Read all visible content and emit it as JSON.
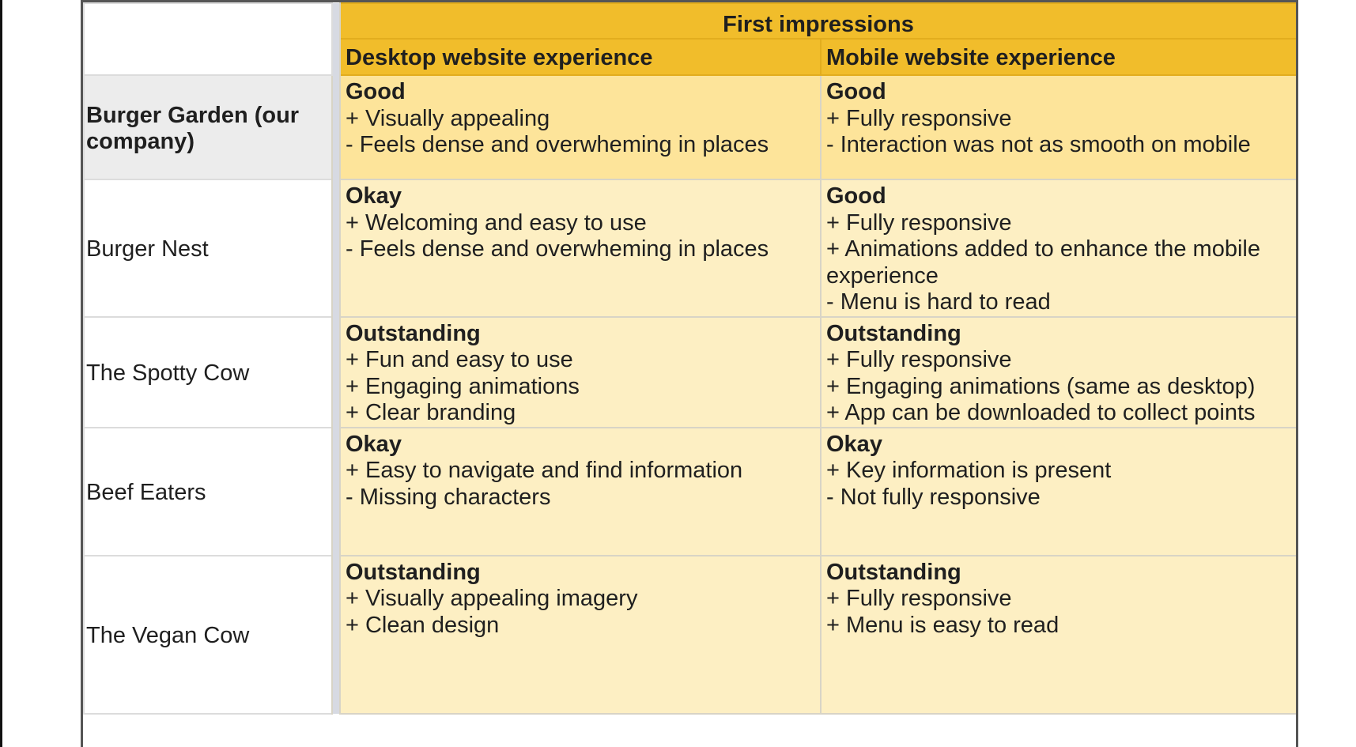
{
  "table": {
    "header": "First impressions",
    "columns": [
      "Desktop website experience",
      "Mobile website experience"
    ],
    "rows": [
      {
        "name": "Burger Garden (our company)",
        "desktop": {
          "rating": "Good",
          "notes": [
            "+ Visually appealing",
            "- Feels dense and overwheming in places"
          ]
        },
        "mobile": {
          "rating": "Good",
          "notes": [
            "+ Fully responsive",
            "- Interaction was not as smooth on mobile"
          ]
        }
      },
      {
        "name": "Burger Nest",
        "desktop": {
          "rating": "Okay",
          "notes": [
            "+ Welcoming and easy to use",
            "- Feels dense and overwheming in places"
          ]
        },
        "mobile": {
          "rating": "Good",
          "notes": [
            "+ Fully responsive",
            "+ Animations added to enhance the mobile experience",
            "- Menu is hard to read"
          ]
        }
      },
      {
        "name": "The Spotty Cow",
        "desktop": {
          "rating": "Outstanding",
          "notes": [
            "+ Fun and easy to use",
            "+ Engaging animations",
            "+ Clear branding"
          ]
        },
        "mobile": {
          "rating": "Outstanding",
          "notes": [
            "+ Fully responsive",
            "+ Engaging animations (same as desktop)",
            "+ App can be downloaded to collect points"
          ]
        }
      },
      {
        "name": "Beef Eaters",
        "desktop": {
          "rating": "Okay",
          "notes": [
            "+ Easy to navigate and find information",
            "- Missing characters"
          ]
        },
        "mobile": {
          "rating": "Okay",
          "notes": [
            "+ Key information is present",
            "- Not fully responsive"
          ]
        }
      },
      {
        "name": "The Vegan Cow",
        "desktop": {
          "rating": "Outstanding",
          "notes": [
            "+ Visually appealing imagery",
            "+ Clean design"
          ]
        },
        "mobile": {
          "rating": "Outstanding",
          "notes": [
            "+ Fully responsive",
            "+ Menu is easy to read"
          ]
        }
      }
    ]
  },
  "colors": {
    "header": "#f1bd2b",
    "highlight_row": "#fde49a",
    "row": "#fdefc3",
    "name_highlight": "#ececec"
  }
}
